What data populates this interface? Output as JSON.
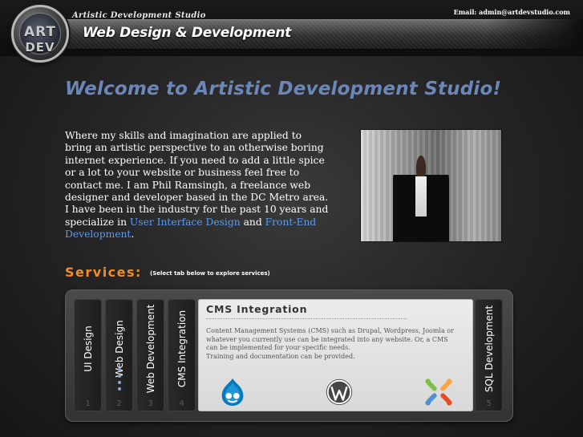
{
  "header": {
    "logo_line1": "ART",
    "logo_line2": "DEV",
    "tagline": "Artistic Development Studio",
    "site_title": "Web Design & Development",
    "email": "Email: admin@artdevstudio.com"
  },
  "main": {
    "welcome": "Welcome to Artistic Development Studio!",
    "intro_text": "Where my skills and imagination are applied to bring an artistic perspective to an otherwise boring internet experience. If you need to add a little spice or a lot to your website or business feel free to contact me. I am Phil Ramsingh, a freelance web designer and developer based in the DC Metro area. I have been in the industry for the past 10 years and specialize in",
    "intro_link1": "User Interface Design",
    "intro_and": "and",
    "intro_link2": "Front-End Development",
    "intro_end": "."
  },
  "services": {
    "title": "Services:",
    "hint": "(Select tab below to explore services)",
    "tabs": [
      {
        "label": "UI Design",
        "num": "1"
      },
      {
        "label": "Web Design",
        "num": "2"
      },
      {
        "label": "Web Development",
        "num": "3"
      },
      {
        "label": "CMS Integration",
        "num": "4"
      },
      {
        "label": "SQL Development",
        "num": "5"
      }
    ],
    "active": {
      "title": "CMS Integration",
      "text": "Content Management Systems (CMS) such as Drupal, Wordpress, Joomla or whatever you currently use can be integrated into any website. Or, a CMS can be implemented for your specific needs.",
      "text2": "Training and documentation can be provided."
    }
  },
  "colors": {
    "welcome": "#6b86b8",
    "services_title": "#f28c2a",
    "link": "#5b9bf0",
    "drupal": "#0678be",
    "joomla_red": "#e44d26",
    "joomla_orange": "#f9a541",
    "joomla_green": "#7ac143",
    "joomla_blue": "#5091cd"
  },
  "icons": [
    "drupal-icon",
    "wordpress-icon",
    "joomla-icon"
  ]
}
